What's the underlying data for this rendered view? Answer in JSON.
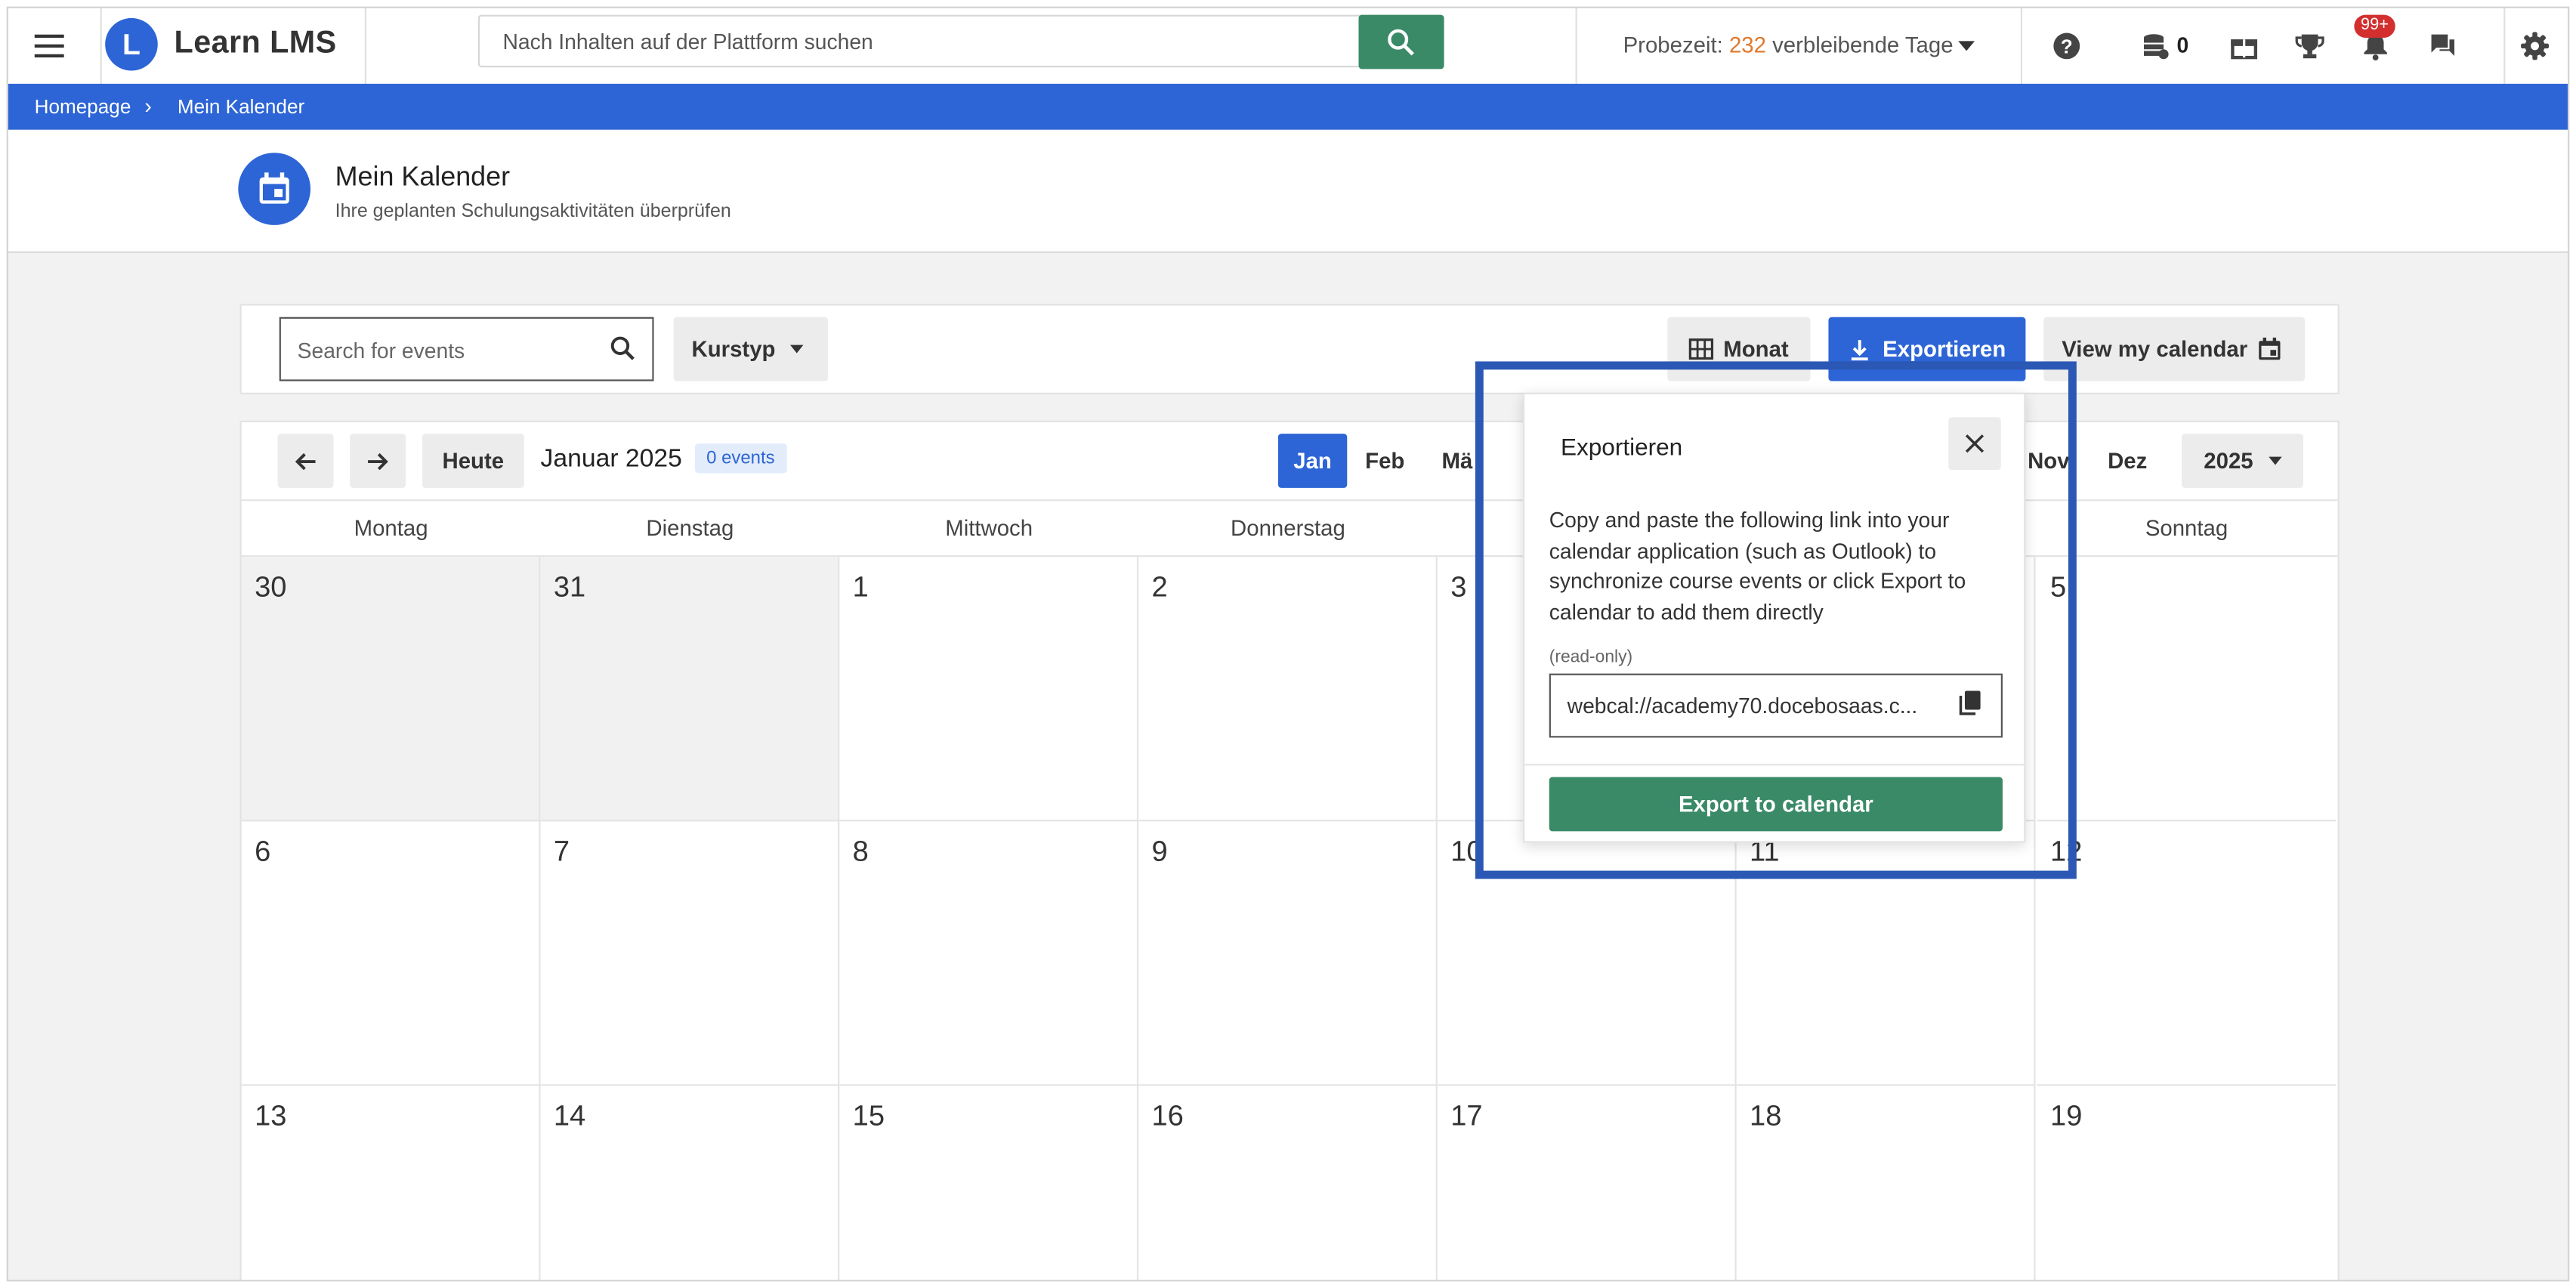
{
  "topbar": {
    "app_name": "Learn LMS",
    "logo_letter": "L",
    "search_placeholder": "Nach Inhalten auf der Plattform suchen",
    "trial_prefix": "Probezeit: ",
    "trial_days": "232",
    "trial_suffix": " verbleibende Tage",
    "coins": "0",
    "notifications_badge": "99+"
  },
  "breadcrumb": {
    "home": "Homepage",
    "separator": "›",
    "current": "Mein Kalender"
  },
  "page": {
    "title": "Mein Kalender",
    "subtitle": "Ihre geplanten Schulungsaktivitäten überprüfen"
  },
  "toolbar": {
    "search_placeholder": "Search for events",
    "course_type": "Kurstyp",
    "month_view": "Monat",
    "export": "Exportieren",
    "view_calendar": "View my calendar"
  },
  "calendar": {
    "today": "Heute",
    "month_label": "Januar 2025",
    "events_badge": "0 events",
    "months": [
      {
        "label": "Jan",
        "active": true
      },
      {
        "label": "Feb"
      },
      {
        "label": "Mä"
      },
      {
        "label": "Nov"
      },
      {
        "label": "Dez"
      }
    ],
    "year": "2025",
    "weekdays": [
      "Montag",
      "Dienstag",
      "Mittwoch",
      "Donnerstag",
      "",
      "",
      "Sonntag"
    ],
    "weeks": [
      [
        {
          "d": "30",
          "out": true
        },
        {
          "d": "31",
          "out": true
        },
        {
          "d": "1"
        },
        {
          "d": "2"
        },
        {
          "d": "3"
        },
        {
          "d": ""
        },
        {
          "d": "5"
        }
      ],
      [
        {
          "d": "6"
        },
        {
          "d": "7"
        },
        {
          "d": "8"
        },
        {
          "d": "9"
        },
        {
          "d": "10"
        },
        {
          "d": "11"
        },
        {
          "d": "12"
        }
      ],
      [
        {
          "d": "13"
        },
        {
          "d": "14"
        },
        {
          "d": "15"
        },
        {
          "d": "16"
        },
        {
          "d": "17"
        },
        {
          "d": "18"
        },
        {
          "d": "19"
        }
      ]
    ]
  },
  "popup": {
    "title": "Exportieren",
    "body": "Copy and paste the following link into your calendar application (such as Outlook) to synchronize course events or click Export to calendar to add them directly",
    "readonly_label": "(read-only)",
    "link": "webcal://academy70.docebosaas.c...",
    "export_button": "Export to calendar"
  },
  "colors": {
    "brand_blue": "#2d65d6",
    "green": "#3a8a68",
    "highlight": "#2b57b5",
    "trial_days": "#e07a2e",
    "badge_red": "#d32f2f"
  }
}
